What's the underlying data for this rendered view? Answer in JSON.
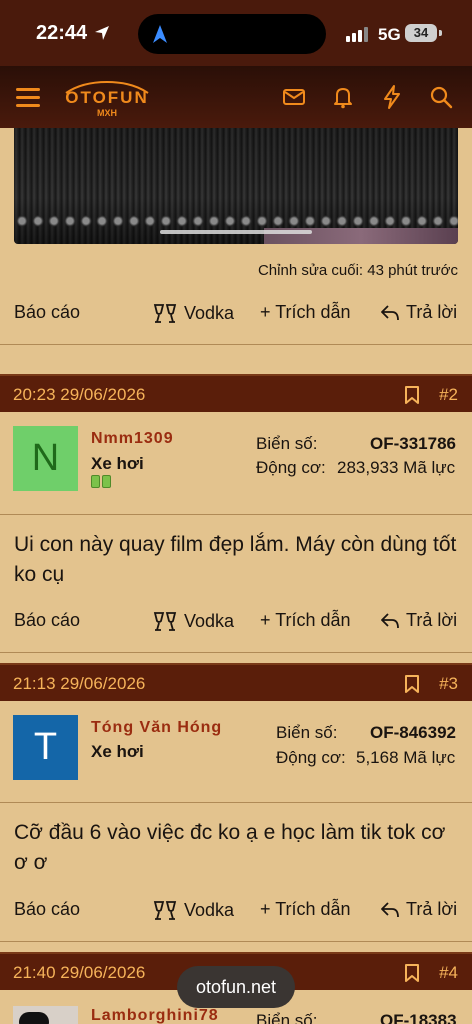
{
  "status": {
    "time": "22:44",
    "network": "5G",
    "battery": "34"
  },
  "header": {
    "logo_text": "OTOFUN",
    "logo_sub": "MXH"
  },
  "first_post": {
    "edited_note": "Chỉnh sửa cuối: 43 phút trước"
  },
  "actions": {
    "report": "Báo cáo",
    "vodka": "Vodka",
    "quote": "+ Trích dẫn",
    "reply": "Trả lời"
  },
  "posts": [
    {
      "time": "20:23 29/06/2026",
      "number": "#2",
      "avatar_letter": "N",
      "avatar_color": "#6fcf6a",
      "username": "Nmm1309",
      "rank": "Xe hơi",
      "plate_label": "Biển số:",
      "plate": "OF-331786",
      "engine_label": "Động cơ:",
      "engine": "283,933 Mã lực",
      "message": "Ui con này quay film đẹp lắm. Máy còn dùng tốt ko cụ"
    },
    {
      "time": "21:13 29/06/2026",
      "number": "#3",
      "avatar_letter": "T",
      "avatar_color": "#1466a8",
      "username": "Tóng Văn Hóng",
      "rank": "Xe hơi",
      "plate_label": "Biển số:",
      "plate": "OF-846392",
      "engine_label": "Động cơ:",
      "engine": "5,168 Mã lực",
      "message": "Cỡ đầu 6 vào việc đc ko ạ e học làm tik tok cơ ơ ơ"
    },
    {
      "time": "21:40 29/06/2026",
      "number": "#4",
      "username": "Lamborghini78",
      "plate_label": "Biển số:",
      "plate": "OF-18383"
    }
  ],
  "footer": {
    "site": "otofun.net"
  },
  "colors": {
    "header_bg": "#4a1a0c",
    "post_head_bg": "#5a1e0a",
    "accent_orange": "#f08a1c",
    "page_bg": "#e3c38e",
    "username_red": "#9a2c10"
  }
}
